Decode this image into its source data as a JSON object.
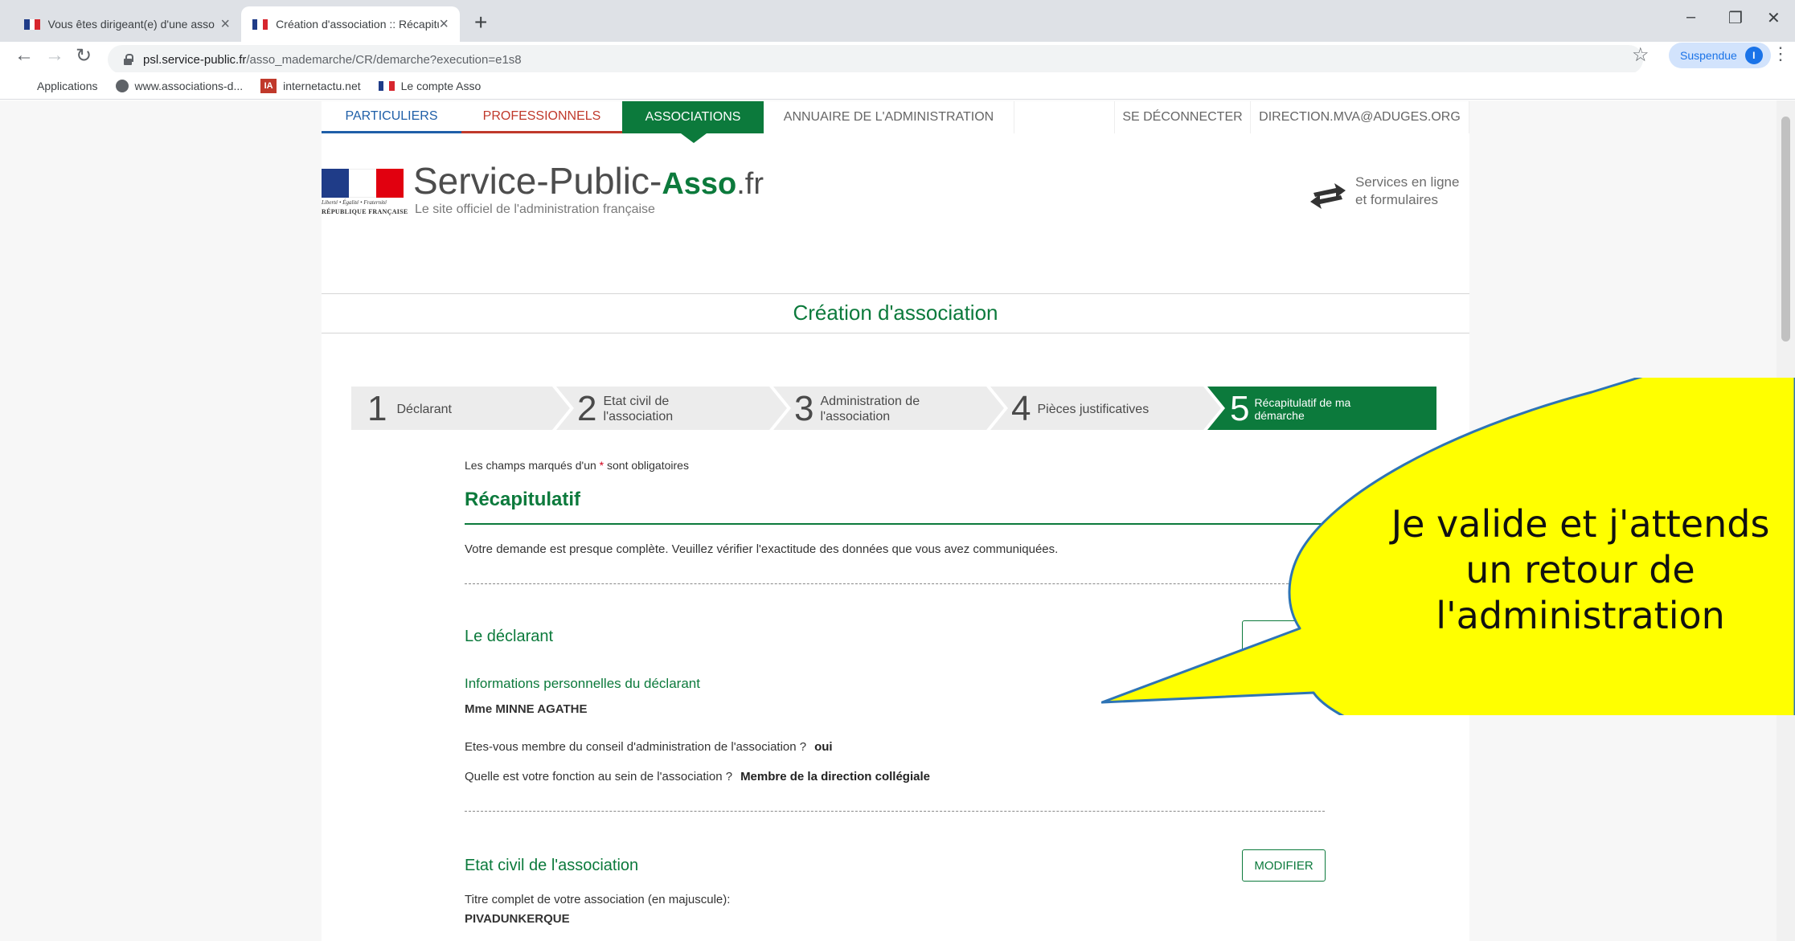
{
  "browser": {
    "tabs": [
      {
        "title": "Vous êtes dirigeant(e) d'une asso",
        "active": false
      },
      {
        "title": "Création d'association :: Récapitu",
        "active": true
      }
    ],
    "address": {
      "host": "psl.service-public.fr",
      "path": "/asso_mademarche/CR/demarche?execution=e1s8"
    },
    "profile_label": "Suspendue",
    "profile_initial": "I",
    "bookmarks": [
      "Applications",
      "www.associations-d...",
      "internetactu.net",
      "Le compte Asso"
    ]
  },
  "site_nav": {
    "particuliers": "PARTICULIERS",
    "professionnels": "PROFESSIONNELS",
    "associations": "ASSOCIATIONS",
    "annuaire": "ANNUAIRE DE L'ADMINISTRATION",
    "logout": "SE DÉCONNECTER",
    "user": "DIRECTION.MVA@ADUGES.ORG"
  },
  "header": {
    "logo_sub1": "Liberté • Égalité • Fraternité",
    "logo_sub2": "RÉPUBLIQUE FRANÇAISE",
    "site_name_main": "Service-Public-",
    "site_name_asso": "Asso",
    "site_name_tld": ".fr",
    "tagline": "Le site officiel de l'administration française",
    "services_line1": "Services en ligne",
    "services_line2": "et formulaires"
  },
  "page_title": "Création d'association",
  "steps": [
    {
      "num": "1",
      "line1": "Déclarant",
      "line2": "",
      "active": false
    },
    {
      "num": "2",
      "line1": "Etat civil de",
      "line2": "l'association",
      "active": false
    },
    {
      "num": "3",
      "line1": "Administration de",
      "line2": "l'association",
      "active": false
    },
    {
      "num": "4",
      "line1": "Pièces justificatives",
      "line2": "",
      "active": false
    },
    {
      "num": "5",
      "line1": "Récapitulatif de ma",
      "line2": "démarche",
      "active": true
    }
  ],
  "form": {
    "required_note_before": "Les champs marqués d'un ",
    "required_star": "*",
    "required_note_after": " sont obligatoires",
    "recap_title": "Récapitulatif",
    "recap_text": "Votre demande est presque complète. Veuillez vérifier l'exactitude des données que vous avez communiquées.",
    "declarant": {
      "title": "Le déclarant",
      "subtitle": "Informations personnelles du déclarant",
      "name": "Mme MINNE AGATHE",
      "q1": "Etes-vous membre du conseil d'administration de l'association ?",
      "a1": "oui",
      "q2": "Quelle est votre fonction au sein de l'association ?",
      "a2": "Membre de la direction collégiale"
    },
    "etat_civil": {
      "title": "Etat civil de l'association",
      "modify": "MODIFIER",
      "field_label": "Titre complet de votre association (en majuscule):",
      "field_value": "PIVADUNKERQUE"
    }
  },
  "callout": {
    "line1": "Je valide et j'attends",
    "line2": "un retour de",
    "line3": "l'administration"
  },
  "colors": {
    "green": "#0c7a3c",
    "callout_fill": "#ffff00",
    "callout_border": "#2e74b5",
    "particuliers": "#1f5fa8",
    "professionnels": "#c0392b"
  }
}
